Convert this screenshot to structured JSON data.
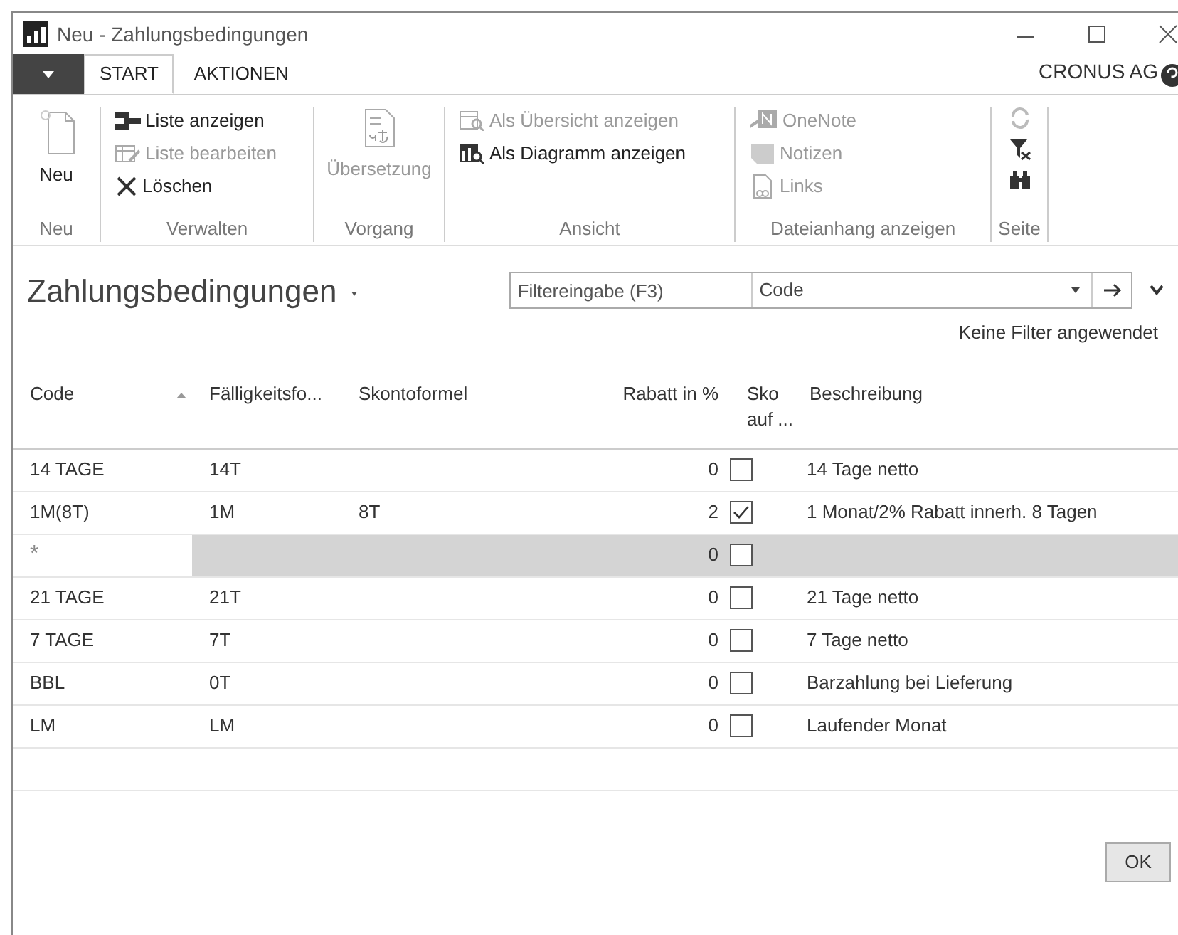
{
  "window": {
    "title": "Neu - Zahlungsbedingungen"
  },
  "tabs": [
    {
      "label": "START",
      "selected": true
    },
    {
      "label": "AKTIONEN",
      "selected": false
    }
  ],
  "company": "CRONUS AG",
  "ribbon": [
    {
      "label": "Neu",
      "kind": "large",
      "items": [
        {
          "label": "Neu",
          "disabled": false
        }
      ]
    },
    {
      "label": "Verwalten",
      "kind": "small",
      "items": [
        {
          "label": "Liste anzeigen",
          "disabled": false
        },
        {
          "label": "Liste bearbeiten",
          "disabled": true
        },
        {
          "label": "Löschen",
          "disabled": false
        }
      ]
    },
    {
      "label": "Vorgang",
      "kind": "large",
      "items": [
        {
          "label": "Übersetzung",
          "disabled": true
        }
      ]
    },
    {
      "label": "Ansicht",
      "kind": "small",
      "items": [
        {
          "label": "Als Übersicht anzeigen",
          "disabled": true
        },
        {
          "label": "Als Diagramm anzeigen",
          "disabled": false
        }
      ]
    },
    {
      "label": "Dateianhang anzeigen",
      "kind": "small",
      "items": [
        {
          "label": "OneNote",
          "disabled": true
        },
        {
          "label": "Notizen",
          "disabled": true
        },
        {
          "label": "Links",
          "disabled": true
        }
      ]
    },
    {
      "label": "Seite",
      "kind": "icons",
      "items": [
        {
          "disabled": true
        },
        {
          "disabled": false
        },
        {
          "disabled": false
        }
      ]
    }
  ],
  "page_title": "Zahlungsbedingungen",
  "filter": {
    "placeholder": "Filtereingabe (F3)",
    "field": "Code"
  },
  "filter_status": "Keine Filter angewendet",
  "table": {
    "columns": [
      "Code",
      "Fälligkeitsfo...",
      "Skontoformel",
      "Rabatt in %",
      "Sko auf ...",
      "Beschreibung"
    ],
    "rows": [
      {
        "code": "14 TAGE",
        "due": "14T",
        "discount": "0",
        "checked": false,
        "description": "14 Tage netto",
        "selected": false
      },
      {
        "code": "1M(8T)",
        "due": "1M",
        "formula": "8T",
        "discount": "2",
        "checked": true,
        "description": "1 Monat/2% Rabatt innerh. 8 Tagen",
        "selected": false
      },
      {
        "code": "*",
        "discount": "0",
        "checked": false,
        "selected": true
      },
      {
        "code": "21 TAGE",
        "due": "21T",
        "discount": "0",
        "checked": false,
        "description": "21 Tage netto",
        "selected": false
      },
      {
        "code": "7 TAGE",
        "due": "7T",
        "discount": "0",
        "checked": false,
        "description": "7 Tage netto",
        "selected": false
      },
      {
        "code": "BBL",
        "due": "0T",
        "discount": "0",
        "checked": false,
        "description": "Barzahlung bei Lieferung",
        "selected": false
      },
      {
        "code": "LM",
        "due": "LM",
        "discount": "0",
        "checked": false,
        "description": "Laufender Monat",
        "selected": false
      }
    ]
  },
  "buttons": [
    "OK"
  ]
}
